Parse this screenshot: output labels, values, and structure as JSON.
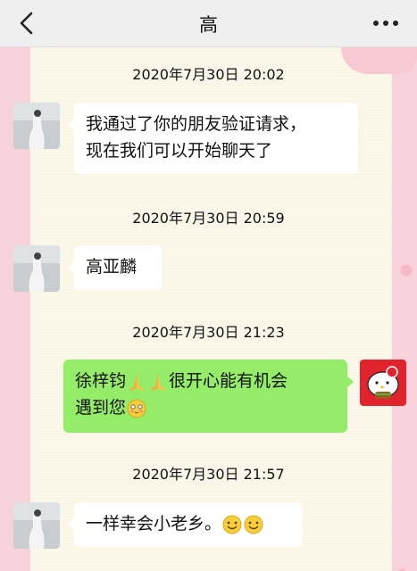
{
  "header": {
    "title": "高",
    "back_icon": "chevron-left-icon",
    "more_icon": "more-dots-icon"
  },
  "messages": [
    {
      "timestamp": "2020年7月30日 20:02",
      "sender": "other",
      "lines": [
        "我通过了你的朋友验证请求，",
        "现在我们可以开始聊天了"
      ]
    },
    {
      "timestamp": "2020年7月30日 20:59",
      "sender": "other",
      "lines": [
        "高亚麟"
      ]
    },
    {
      "timestamp": "2020年7月30日 21:23",
      "sender": "me",
      "text_a": "徐梓钧",
      "text_b": "很开心能有机会",
      "text_c": "遇到您",
      "emojis": [
        "praying-hands-icon",
        "praying-hands-icon",
        "blushing-face-icon"
      ]
    },
    {
      "timestamp": "2020年7月30日 21:57",
      "sender": "other",
      "text": "一样幸会小老乡。",
      "emojis": [
        "smiling-face-icon",
        "smiling-face-icon"
      ]
    }
  ],
  "colors": {
    "my_bubble": "#95ec69",
    "their_bubble": "#ffffff",
    "background_pink": "#f8d2da",
    "paper": "#fbf8ea"
  }
}
